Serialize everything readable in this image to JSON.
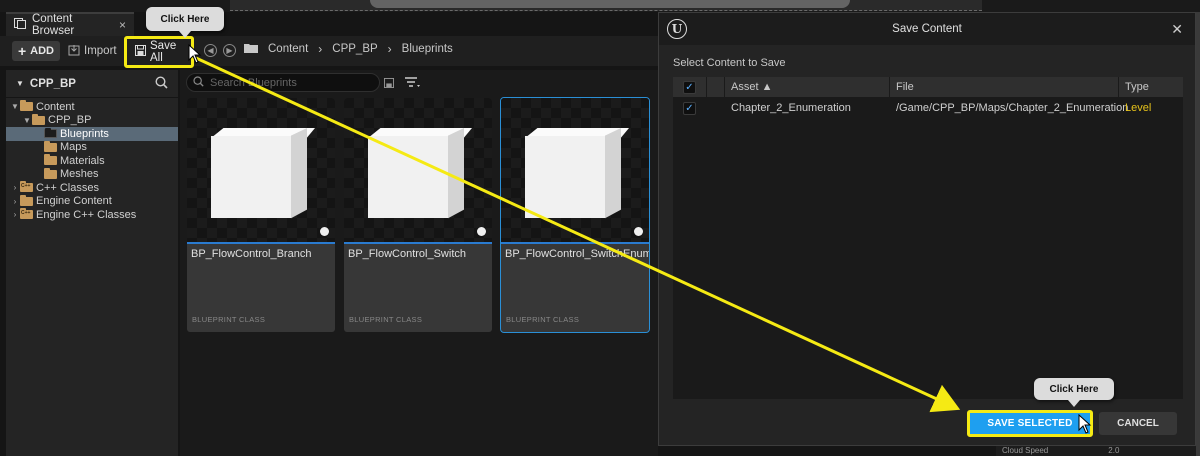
{
  "tab": {
    "title": "Content Browser",
    "close": "×"
  },
  "toolbar": {
    "add_label": "ADD",
    "import_label": "Import",
    "save_all_label": "Save All",
    "breadcrumb": [
      "Content",
      "CPP_BP",
      "Blueprints"
    ]
  },
  "sidebar": {
    "title": "CPP_BP",
    "items": [
      {
        "label": "Content",
        "indent": 0,
        "arrow": "down",
        "type": "folder"
      },
      {
        "label": "CPP_BP",
        "indent": 1,
        "arrow": "down",
        "type": "folder"
      },
      {
        "label": "Blueprints",
        "indent": 2,
        "arrow": "",
        "type": "dark",
        "selected": true
      },
      {
        "label": "Maps",
        "indent": 2,
        "arrow": "",
        "type": "folder"
      },
      {
        "label": "Materials",
        "indent": 2,
        "arrow": "",
        "type": "folder"
      },
      {
        "label": "Meshes",
        "indent": 2,
        "arrow": "",
        "type": "folder"
      },
      {
        "label": "C++ Classes",
        "indent": 0,
        "arrow": "right",
        "type": "cpp"
      },
      {
        "label": "Engine Content",
        "indent": 0,
        "arrow": "right",
        "type": "folder"
      },
      {
        "label": "Engine C++ Classes",
        "indent": 0,
        "arrow": "right",
        "type": "cpp"
      }
    ]
  },
  "search": {
    "placeholder": "Search Blueprints"
  },
  "assets": [
    {
      "name": "BP_FlowControl_Branch",
      "class": "BLUEPRINT CLASS",
      "selected": false
    },
    {
      "name": "BP_FlowControl_Switch",
      "class": "BLUEPRINT CLASS",
      "selected": false
    },
    {
      "name": "BP_FlowControl_SwitchEnum",
      "class": "BLUEPRINT CLASS",
      "selected": true
    }
  ],
  "dialog": {
    "title": "Save Content",
    "logo": "U",
    "close": "✕",
    "subtitle": "Select Content to Save",
    "columns": {
      "asset": "Asset ▲",
      "file": "File",
      "type": "Type"
    },
    "rows": [
      {
        "checked": true,
        "asset": "Chapter_2_Enumeration",
        "file": "/Game/CPP_BP/Maps/Chapter_2_Enumeration",
        "type": "Level"
      }
    ],
    "save_selected_label": "SAVE SELECTED",
    "cancel_label": "CANCEL"
  },
  "details": {
    "label": "Cloud Speed",
    "value": "2.0"
  },
  "callouts": {
    "first": "Click Here",
    "second": "Click Here"
  },
  "colors": {
    "highlight": "#f5ea14",
    "accent": "#1e9ff0",
    "level": "#e6c21a"
  }
}
